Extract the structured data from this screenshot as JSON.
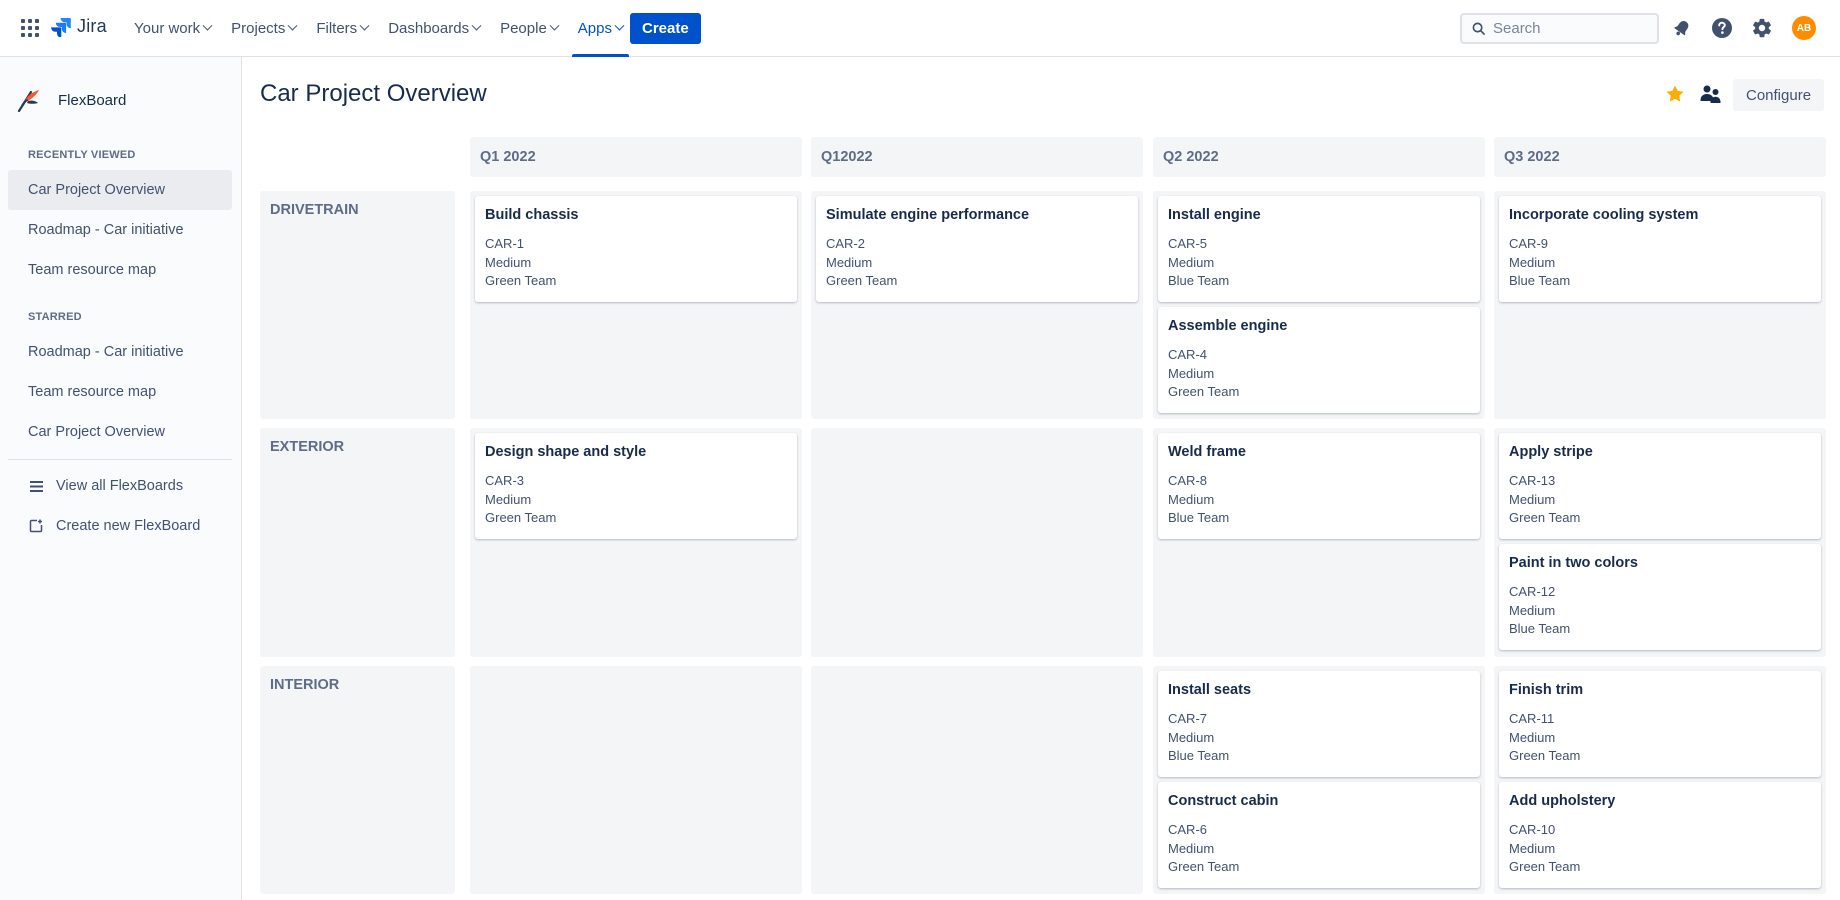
{
  "nav": {
    "product": "Jira",
    "items": [
      {
        "label": "Your work"
      },
      {
        "label": "Projects"
      },
      {
        "label": "Filters"
      },
      {
        "label": "Dashboards"
      },
      {
        "label": "People"
      },
      {
        "label": "Apps",
        "active": true
      }
    ],
    "create_label": "Create",
    "search_placeholder": "Search",
    "avatar_initials": "AB",
    "colors": {
      "brand": "#0052cc",
      "avatar": "#ff8b00"
    }
  },
  "sidebar": {
    "app_name": "FlexBoard",
    "recently_viewed_heading": "RECENTLY VIEWED",
    "recently_viewed": [
      {
        "label": "Car Project Overview",
        "active": true
      },
      {
        "label": "Roadmap - Car initiative"
      },
      {
        "label": "Team resource map"
      }
    ],
    "starred_heading": "STARRED",
    "starred": [
      {
        "label": "Roadmap - Car initiative"
      },
      {
        "label": "Team resource map"
      },
      {
        "label": "Car Project Overview"
      }
    ],
    "view_all_label": "View all FlexBoards",
    "create_new_label": "Create new FlexBoard"
  },
  "board": {
    "title": "Car Project Overview",
    "configure_label": "Configure",
    "star_color": "#ffab00",
    "columns": [
      "Q1 2022",
      "Q12022",
      "Q2 2022",
      "Q3 2022"
    ],
    "rows": [
      {
        "label": "DRIVETRAIN",
        "cells": [
          [
            {
              "title": "Build chassis",
              "key": "CAR-1",
              "priority": "Medium",
              "team": "Green Team"
            }
          ],
          [
            {
              "title": "Simulate engine performance",
              "key": "CAR-2",
              "priority": "Medium",
              "team": "Green Team"
            }
          ],
          [
            {
              "title": "Install engine",
              "key": "CAR-5",
              "priority": "Medium",
              "team": "Blue Team"
            },
            {
              "title": "Assemble engine",
              "key": "CAR-4",
              "priority": "Medium",
              "team": "Green Team"
            }
          ],
          [
            {
              "title": "Incorporate cooling system",
              "key": "CAR-9",
              "priority": "Medium",
              "team": "Blue Team"
            }
          ]
        ]
      },
      {
        "label": "EXTERIOR",
        "cells": [
          [
            {
              "title": "Design shape and style",
              "key": "CAR-3",
              "priority": "Medium",
              "team": "Green Team"
            }
          ],
          [],
          [
            {
              "title": "Weld frame",
              "key": "CAR-8",
              "priority": "Medium",
              "team": "Blue Team"
            }
          ],
          [
            {
              "title": "Apply stripe",
              "key": "CAR-13",
              "priority": "Medium",
              "team": "Green Team"
            },
            {
              "title": "Paint in two colors",
              "key": "CAR-12",
              "priority": "Medium",
              "team": "Blue Team"
            }
          ]
        ]
      },
      {
        "label": "INTERIOR",
        "cells": [
          [],
          [],
          [
            {
              "title": "Install seats",
              "key": "CAR-7",
              "priority": "Medium",
              "team": "Blue Team"
            },
            {
              "title": "Construct cabin",
              "key": "CAR-6",
              "priority": "Medium",
              "team": "Green Team"
            }
          ],
          [
            {
              "title": "Finish trim",
              "key": "CAR-11",
              "priority": "Medium",
              "team": "Green Team"
            },
            {
              "title": "Add upholstery",
              "key": "CAR-10",
              "priority": "Medium",
              "team": "Green Team"
            }
          ]
        ]
      }
    ]
  }
}
